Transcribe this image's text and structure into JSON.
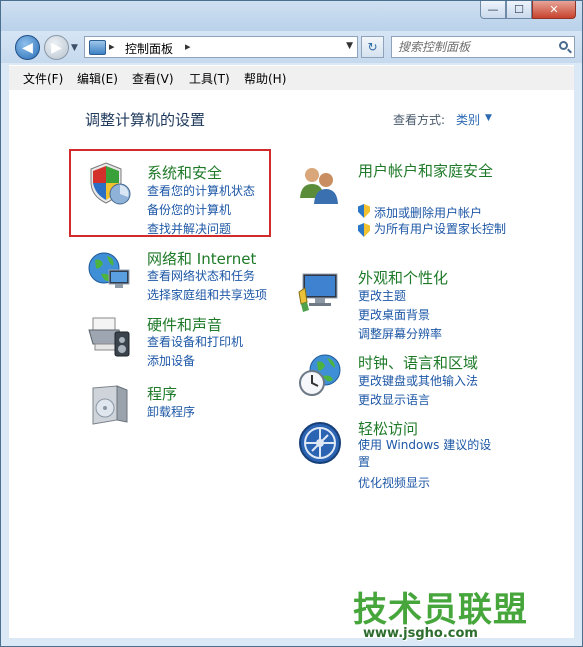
{
  "window": {
    "minimize_glyph": "—",
    "maximize_glyph": "☐",
    "close_glyph": "✕"
  },
  "address": {
    "back_glyph": "◀",
    "forward_glyph": "▶",
    "recent_glyph": "▼",
    "sep1": "▸",
    "path": "控制面板",
    "sep2": "▸",
    "dropdown_glyph": "▼",
    "refresh_glyph": "↻",
    "search_placeholder": "搜索控制面板"
  },
  "menu": [
    "文件(F)",
    "编辑(E)",
    "查看(V)",
    "工具(T)",
    "帮助(H)"
  ],
  "page": {
    "heading": "调整计算机的设置",
    "view_by_label": "查看方式:",
    "view_by_value": "类别",
    "view_by_glyph": "▼"
  },
  "categories": {
    "system_security": {
      "title": "系统和安全",
      "links": [
        "查看您的计算机状态",
        "备份您的计算机",
        "查找并解决问题"
      ]
    },
    "network": {
      "title": "网络和 Internet",
      "links": [
        "查看网络状态和任务",
        "选择家庭组和共享选项"
      ]
    },
    "hardware": {
      "title": "硬件和声音",
      "links": [
        "查看设备和打印机",
        "添加设备"
      ]
    },
    "programs": {
      "title": "程序",
      "links": [
        "卸载程序"
      ]
    },
    "user_accounts": {
      "title": "用户帐户和家庭安全",
      "links": [
        "添加或删除用户帐户",
        "为所有用户设置家长控制"
      ]
    },
    "appearance": {
      "title": "外观和个性化",
      "links": [
        "更改主题",
        "更改桌面背景",
        "调整屏幕分辨率"
      ]
    },
    "clock": {
      "title": "时钟、语言和区域",
      "links": [
        "更改键盘或其他输入法",
        "更改显示语言"
      ]
    },
    "ease": {
      "title": "轻松访问",
      "links": [
        "使用 Windows 建议的设置",
        "优化视频显示"
      ]
    }
  },
  "watermark": {
    "text": "技术员联盟",
    "url": "www.jsgho.com"
  },
  "colors": {
    "category_title": "#1e7a28",
    "link": "#1d57a6",
    "highlight_box": "#d12b2b"
  }
}
